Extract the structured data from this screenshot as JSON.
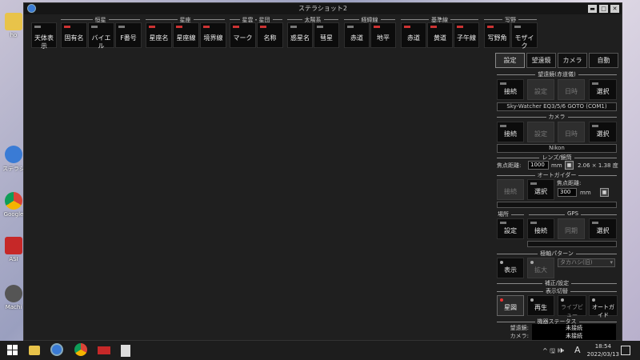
{
  "desktop": {
    "icons": [
      {
        "label": "ho",
        "icon": "folder-icon",
        "color": "#e8c34a"
      },
      {
        "label": "ステラシ",
        "icon": "stellashot-icon",
        "color": "#3a7bd5"
      },
      {
        "label": "Google",
        "icon": "chrome-icon",
        "color": "#4caf50"
      },
      {
        "label": "ASI",
        "icon": "asi-icon",
        "color": "#c62828"
      },
      {
        "label": "Machi",
        "icon": "gear-icon",
        "color": "#555555"
      }
    ]
  },
  "window": {
    "title": "ステラショット2",
    "minimize": "▬",
    "maximize": "□",
    "close": "✕"
  },
  "toolbar": {
    "standalone": {
      "label": "天体表示"
    },
    "groups": [
      {
        "label": "恒星",
        "buttons": [
          "固有名",
          "バイエル",
          "F番号"
        ]
      },
      {
        "label": "星座",
        "buttons": [
          "星座名",
          "星座線",
          "境界線"
        ]
      },
      {
        "label": "星雲・星団",
        "buttons": [
          "マーク",
          "名称"
        ]
      },
      {
        "label": "太陽系",
        "buttons": [
          "惑星名",
          "彗星"
        ]
      },
      {
        "label": "経緯線",
        "buttons": [
          "赤道",
          "地平"
        ]
      },
      {
        "label": "基準線",
        "buttons": [
          "赤道",
          "黄道",
          "子午線"
        ]
      },
      {
        "label": "写野",
        "buttons": [
          "写野角",
          "モザイク"
        ]
      }
    ]
  },
  "panel": {
    "tabs": [
      "設定",
      "望遠鏡",
      "カメラ",
      "自動"
    ],
    "telescope": {
      "title": "望遠鏡(赤道儀)",
      "connect": "接続",
      "settings": "設定",
      "time": "日時",
      "select": "選択",
      "device": "Sky-Watcher EQ3/5/6 GOTO (COM1)"
    },
    "camera": {
      "title": "カメラ",
      "connect": "接続",
      "settings": "設定",
      "time": "日時",
      "select": "選択",
      "device": "Nikon"
    },
    "lens": {
      "title": "レンズ/鏡筒",
      "focal_label": "焦点距離:",
      "focal_value": "1000",
      "unit": "mm",
      "fov": "2.06 × 1.38 度"
    },
    "autoguider": {
      "title": "オートガイダー",
      "connect": "接続",
      "select": "選択",
      "focal_label": "焦点距離:",
      "focal_value": "300",
      "unit": "mm"
    },
    "location": {
      "title": "場所",
      "gps_title": "GPS",
      "settings": "設定",
      "connect": "接続",
      "sync": "同期",
      "select": "選択"
    },
    "polar": {
      "title": "極軸パターン",
      "show": "表示",
      "zoom": "拡大",
      "select_value": "タカハシ(旧)"
    },
    "correction": {
      "title": "補正/設定"
    },
    "display": {
      "title": "表示切替",
      "star_map": "星図",
      "playback": "再生",
      "live_view": "ライブビュー",
      "autoguide": "オートガイド"
    },
    "status": {
      "title": "機器ステータス",
      "telescope_label": "望遠鏡:",
      "telescope_value": "未接続",
      "camera_label": "カメラ:",
      "camera_value": "未接続"
    }
  },
  "taskbar": {
    "time": "18:54",
    "date": "2022/03/13",
    "ime": "A",
    "tray_icons": "^ 🖫 🕪"
  }
}
